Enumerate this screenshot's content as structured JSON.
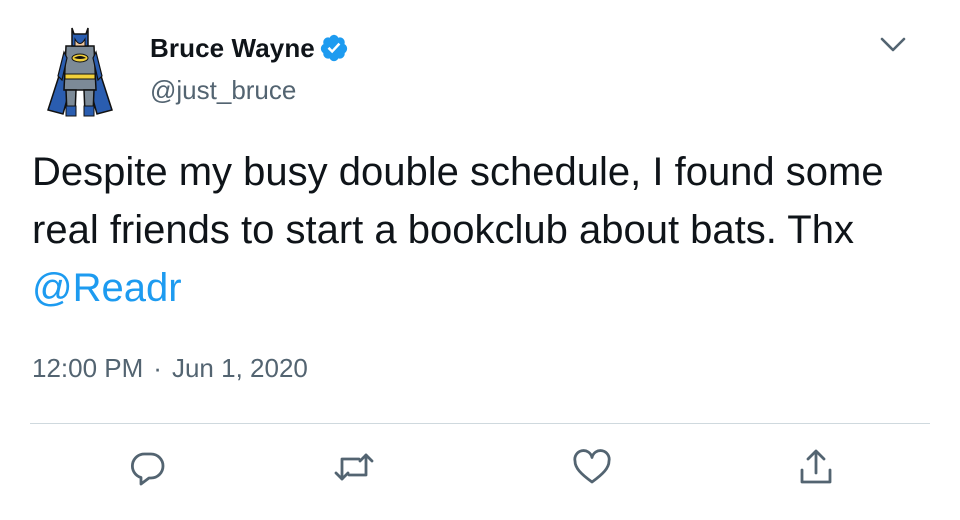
{
  "tweet": {
    "author": {
      "display_name": "Bruce Wayne",
      "handle": "@just_bruce",
      "verified": true,
      "avatar": "batman-avatar"
    },
    "text_before_mention": "Despite my busy double schedule, I found some real friends to start a bookclub about bats. Thx ",
    "mention": "@Readr",
    "time": "12:00 PM",
    "separator": "·",
    "date": "Jun 1, 2020"
  },
  "actions": [
    {
      "name": "reply",
      "icon": "reply-bubble-icon"
    },
    {
      "name": "retweet",
      "icon": "retweet-icon"
    },
    {
      "name": "like",
      "icon": "heart-icon"
    },
    {
      "name": "share",
      "icon": "share-upload-icon"
    }
  ],
  "colors": {
    "text": "#0f1419",
    "secondary": "#536471",
    "accent": "#1d9bf0",
    "divider": "#cfd9de"
  }
}
